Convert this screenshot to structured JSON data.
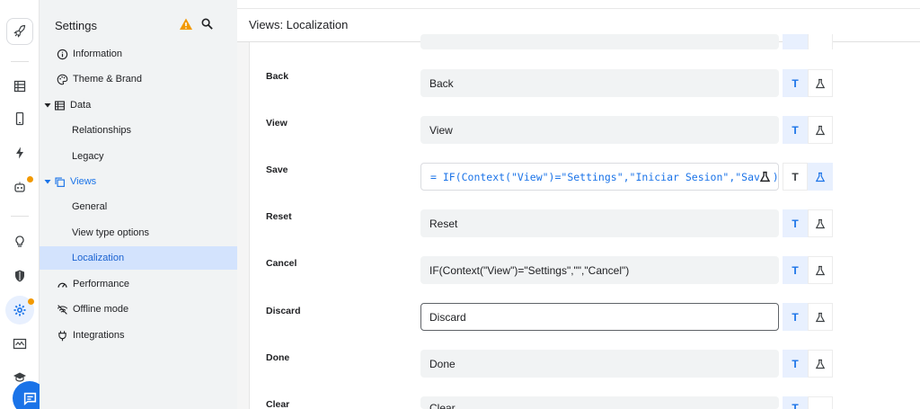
{
  "sidebar": {
    "title": "Settings",
    "items": [
      {
        "label": "Information"
      },
      {
        "label": "Theme & Brand"
      },
      {
        "label": "Data"
      },
      {
        "label": "Relationships"
      },
      {
        "label": "Legacy"
      },
      {
        "label": "Views"
      },
      {
        "label": "General"
      },
      {
        "label": "View type options"
      },
      {
        "label": "Localization"
      },
      {
        "label": "Performance"
      },
      {
        "label": "Offline mode"
      },
      {
        "label": "Integrations"
      }
    ]
  },
  "main": {
    "title": "Views: Localization",
    "rows": [
      {
        "label": "Back",
        "value": "Back"
      },
      {
        "label": "View",
        "value": "View"
      },
      {
        "label": "Save",
        "value": "= IF(Context(\"View\")=\"Settings\",\"Iniciar Sesion\",\"Save\")"
      },
      {
        "label": "Reset",
        "value": "Reset"
      },
      {
        "label": "Cancel",
        "value": "IF(Context(\"View\")=\"Settings\",\"\",\"Cancel\")"
      },
      {
        "label": "Discard",
        "value": "Discard"
      },
      {
        "label": "Done",
        "value": "Done"
      },
      {
        "label": "Clear",
        "value": "Clear"
      }
    ],
    "toggle_text_label": "T"
  },
  "colors": {
    "accent": "#1a73e8",
    "active_bg": "#d3e3fd",
    "warning": "#f29900"
  }
}
